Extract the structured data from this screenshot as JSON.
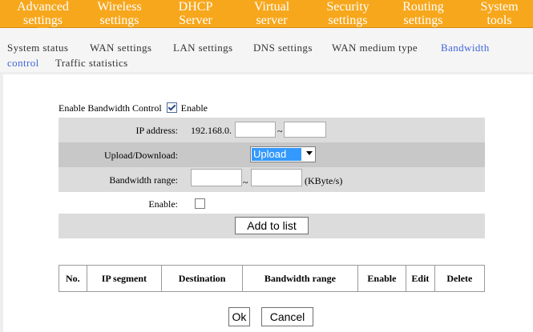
{
  "nav": {
    "tabs": [
      {
        "label": "Advanced\nsettings"
      },
      {
        "label": "Wireless\nsettings"
      },
      {
        "label": "DHCP\nServer"
      },
      {
        "label": "Virtual\nserver"
      },
      {
        "label": "Security\nsettings"
      },
      {
        "label": "Routing\nsettings"
      },
      {
        "label": "System\ntools"
      }
    ],
    "active_color": "#f7a71c"
  },
  "subnav": {
    "items": [
      {
        "label": "System status"
      },
      {
        "label": "WAN settings"
      },
      {
        "label": "LAN settings"
      },
      {
        "label": "DNS settings"
      },
      {
        "label": "WAN medium type"
      },
      {
        "label": "Bandwidth"
      },
      {
        "label": "control"
      },
      {
        "label": "Traffic statistics"
      }
    ],
    "active": "Bandwidth control",
    "active_color": "#3f66d8"
  },
  "form": {
    "enable_bw_label": "Enable Bandwidth Control",
    "enable_bw_checked": true,
    "enable_bw_text": "Enable",
    "ip_label": "IP address:",
    "ip_prefix": "192.168.0.",
    "ip_start": "",
    "ip_tilde": "~",
    "ip_end": "",
    "updown_label": "Upload/Download:",
    "updown_value": "Upload",
    "bw_label": "Bandwidth range:",
    "bw_min": "",
    "bw_tilde": "~",
    "bw_max": "",
    "bw_unit": "(KByte/s)",
    "enable_label": "Enable:",
    "enable_checked": false,
    "add_button": "Add to list"
  },
  "table": {
    "headers": [
      "No.",
      "IP segment",
      "Destination",
      "Bandwidth range",
      "Enable",
      "Edit",
      "Delete"
    ]
  },
  "footer": {
    "ok": "Ok",
    "cancel": "Cancel"
  }
}
